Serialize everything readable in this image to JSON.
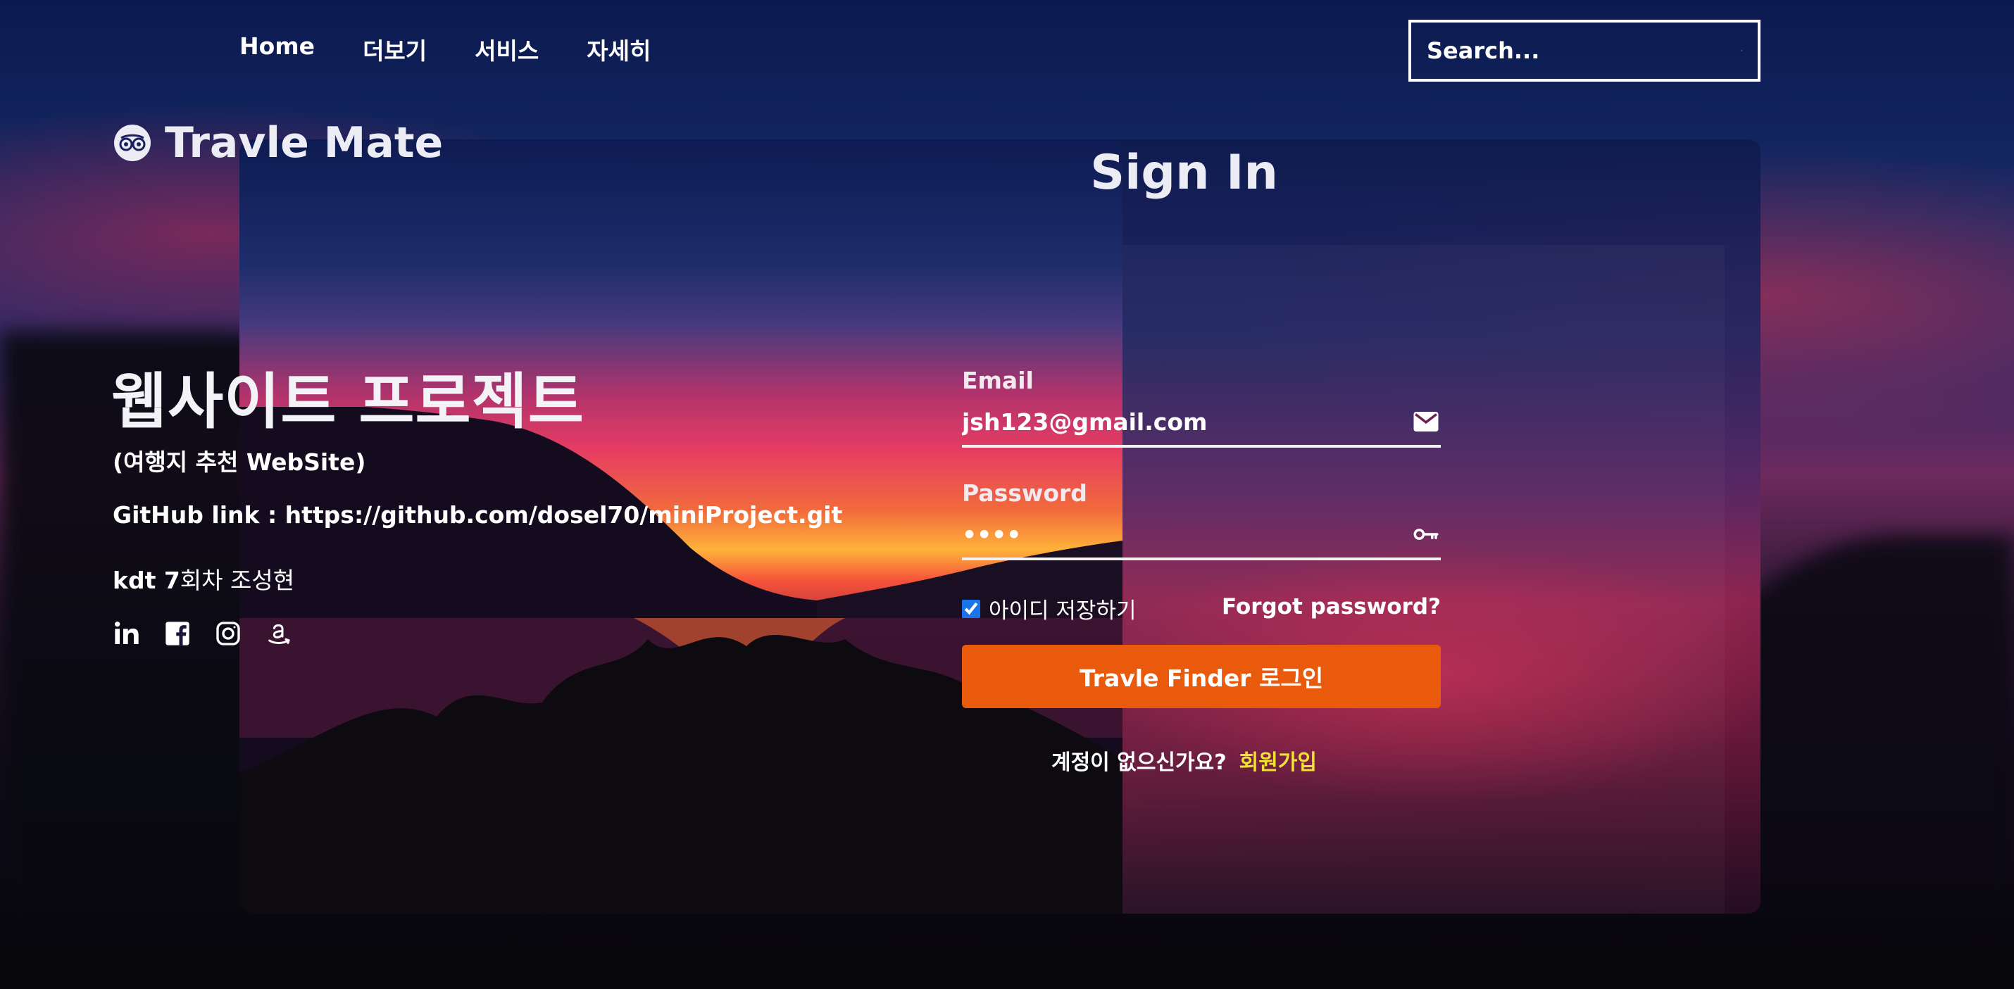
{
  "nav": {
    "links": [
      {
        "label": "Home"
      },
      {
        "label": "더보기"
      },
      {
        "label": "서비스"
      },
      {
        "label": "자세히"
      }
    ],
    "search": {
      "placeholder": "Search..."
    }
  },
  "brand": {
    "name": "Travle Mate",
    "icon": "tripadvisor-owl-icon"
  },
  "project": {
    "title": "웹사이트 프로젝트",
    "subtitle": "(여행지 추천 WebSite)",
    "github_line": "GitHub link : https://github.com/dosel70/miniProject.git",
    "author_bold": "kdt 7",
    "author_rest": "회차 조성현"
  },
  "social": [
    {
      "icon": "linkedin-icon"
    },
    {
      "icon": "facebook-icon"
    },
    {
      "icon": "instagram-icon"
    },
    {
      "icon": "amazon-icon"
    }
  ],
  "signin": {
    "title": "Sign In",
    "email_label": "Email",
    "email_value": "jsh123@gmail.com",
    "password_label": "Password",
    "password_value": "••••",
    "remember_label": "아이디 저장하기",
    "remember_checked": true,
    "forgot_label": "Forgot password?",
    "login_button": "Travle Finder 로그인",
    "no_account_text": "계정이 없으신가요?",
    "signup_link": "회원가입"
  },
  "colors": {
    "accent_button": "#e95a0c",
    "signup_link": "#f0e134"
  }
}
